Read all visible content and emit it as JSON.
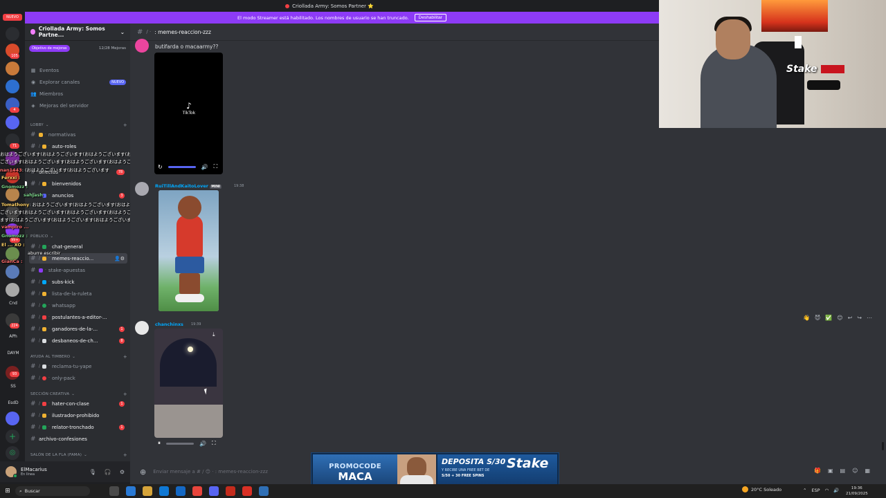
{
  "window": {
    "title": "Criollada Army: Somos Partner ⭐"
  },
  "banner": {
    "text": "El modo Streamer está habilitado. Los nombres de usuario se han truncado.",
    "button": "Deshabilitar"
  },
  "rail": {
    "nuevo": "NUEVO",
    "badges": [
      "136",
      "105",
      "4",
      "71",
      "4",
      "23",
      "99+",
      "4",
      "1",
      "7",
      "1",
      "224",
      "93"
    ],
    "labels": [
      "Cnd",
      "APh",
      "DAYM",
      "SS",
      "EsdD"
    ]
  },
  "server": {
    "name": "Criollada Army: Somos Partne...",
    "boost_label": "Objetivo de mejoras",
    "boost_count": "12/28 Mejoras",
    "items": [
      {
        "label": "Eventos",
        "icon": "calendar-icon"
      },
      {
        "label": "Explorar canales",
        "icon": "compass-icon",
        "badge": "NUEVO"
      },
      {
        "label": "Miembros",
        "icon": "members-icon"
      },
      {
        "label": "Mejoras del servidor",
        "icon": "boost-icon"
      }
    ]
  },
  "categories": {
    "lobby": "LOBBY",
    "publico": "PÚBLICO",
    "ayuda": "AYUDA AL TIMBERO",
    "creativa": "SECCIÓN CREATIVA",
    "salon": "SALÓN DE LA FLA (FAMA)"
  },
  "channels": {
    "normativas": "normativas",
    "auto_roles": "auto-roles",
    "directos": "directos",
    "directos_count": "78",
    "bienvenidos": "bienvenidos",
    "anuncios": "anuncios",
    "anuncios_count": "3",
    "chat_general": "chat-general",
    "memes": "memes-reaccio...",
    "stake": "stake-apuestas",
    "subs_kick": "subs-kick",
    "ruleta": "lista-de-la-ruleta",
    "whatsapp": "whatsapp",
    "postulantes": "postulantes-a-editor-...",
    "ganadores": "ganadores-de-la-...",
    "ganadores_count": "1",
    "desbaneos": "desbaneos-de-ch...",
    "desbaneos_count": "8",
    "reclama": "reclama-tu-yape",
    "only_pack": "only-pack",
    "hater": "hater-con-clase",
    "hater_count": "1",
    "ilustrador": "ilustrador-prohibido",
    "relator": "relator-tronchado",
    "relator_count": "1",
    "archivo": "archivo-confesiones"
  },
  "overlay": {
    "line1": "おはようございます(おはようございます(おはようございます(おはようございます",
    "line2": "ございます(おはようございます(おはようございます(おはようございます",
    "line3_name": "nan1443",
    "line3": ": (おはようございます(おはようございます",
    "name_ferxxi": "Ferxxi :",
    "name_gnomozz": "Gnomozz :",
    "name_sahjash": "sahjash",
    "line4_name": "Tomathony",
    "line4": ": おはようございます(おはようございます(おはようございます(おはようござい",
    "line5": "ございます(おはようございます(おはようございます(おはようございます(おはようございます",
    "line6": "ます(おはようございます(おはようございます(おはようございます",
    "name_vampiro": "vampiro ...",
    "name_gnomozz2": "Gnomozz :",
    "name_el": "El ... XO :",
    "line7": "aburre escribir",
    "name_gianca": "GianCa :"
  },
  "user": {
    "name": "ElMacarius",
    "status": "En línea"
  },
  "channel_header": {
    "prefix": "/ ·",
    "name": ": memes-reaccion-zzz"
  },
  "messages": [
    {
      "text": "butifarda o macaarmy??"
    },
    {
      "author": "RuiTillAndKaitoLover",
      "tag": "MINI",
      "time": "19:38"
    },
    {
      "author": "chanchinxs",
      "time": "19:39"
    }
  ],
  "tiktok": {
    "logo": "TikTok",
    "sub": "Lite"
  },
  "input": {
    "placeholder": "Enviar mensaje a # / 😊 · : memes-reaccion-zzz"
  },
  "reactions": [
    "👋",
    "😈",
    "✅",
    "😊",
    "↩",
    "↪",
    "⋯"
  ],
  "ad": {
    "promocode": "PROMOCODE",
    "code": "MACA",
    "deposit": "DEPOSITA S/30",
    "brand": "Stake",
    "line1": "Y RECIBE UNA FREE BET DE",
    "line2": "S/50 + 30 FREE SPINS"
  },
  "taskbar": {
    "search": "Buscar",
    "weather": "20°C  Soleado",
    "lang": "ESP",
    "time": "19:36",
    "date": "21/09/2025"
  },
  "colors": {
    "accent": "#5865f2",
    "banner": "#8d3bf6",
    "mention": "#f23f43"
  }
}
